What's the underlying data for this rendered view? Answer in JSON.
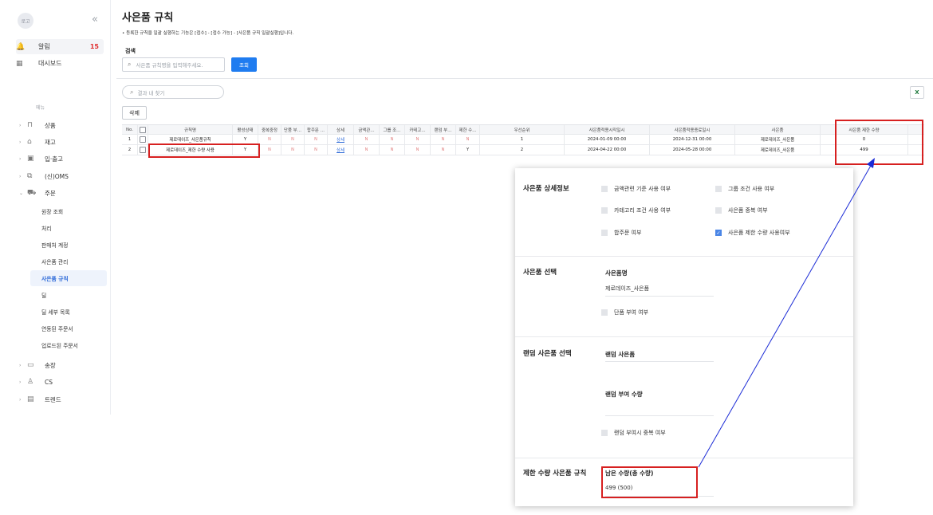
{
  "sidebar": {
    "logo": "로고",
    "collapse": "«",
    "top_items": [
      {
        "label": "알림",
        "badge": "15"
      },
      {
        "label": "대시보드"
      }
    ],
    "menu_label": "메뉴",
    "groups": [
      {
        "label": "상품",
        "arrow": "›"
      },
      {
        "label": "재고",
        "arrow": "›"
      },
      {
        "label": "입·출고",
        "arrow": "›"
      },
      {
        "label": "(신)OMS",
        "arrow": "›"
      },
      {
        "label": "주문",
        "arrow": "⌄"
      }
    ],
    "order_subitems": [
      "원장 조회",
      "처리",
      "판매처 계정",
      "사은품 관리",
      "사은품 규칙",
      "딜",
      "딜 세부 목록",
      "연동된 주문서",
      "업로드된 주문서"
    ],
    "groups_bottom": [
      {
        "label": "송장",
        "arrow": "›"
      },
      {
        "label": "CS",
        "arrow": "›"
      },
      {
        "label": "트렌드",
        "arrow": "›"
      }
    ]
  },
  "main": {
    "title": "사은품 규칙",
    "notice": "• 등록한 규칙을 일괄 실행하는 기능은 [접수] - [접수 가능] - [사은품 규칙 일괄실행]입니다.",
    "search_label": "검색",
    "search_placeholder": "사은품 규칙명을 입력해주세요.",
    "search_button": "조회",
    "find_placeholder": "결과 내 찾기",
    "delete_button": "삭제",
    "excel_icon": "excel-icon"
  },
  "grid": {
    "headers": [
      "No.",
      "",
      "규칙명",
      "활성상태",
      "중복중정",
      "단품 부…",
      "합주문 …",
      "상세",
      "금액관…",
      "그룹 조…",
      "카테고…",
      "랜덤 부…",
      "제한 수…",
      "우선순위",
      "사은품적용시작일시",
      "사은품적용종료일시",
      "사은품",
      "사은품 제한 수량"
    ],
    "rows": [
      [
        "1",
        "",
        "제로데이즈_사은품규칙",
        "Y",
        "N",
        "N",
        "N",
        "상세",
        "N",
        "N",
        "N",
        "N",
        "N",
        "1",
        "2024-01-09 00:00",
        "2024-12-31 00:00",
        "제로데이즈_사은품",
        "0"
      ],
      [
        "2",
        "",
        "제로데이즈_제한 수량 사용",
        "Y",
        "N",
        "N",
        "N",
        "상세",
        "N",
        "N",
        "N",
        "N",
        "Y",
        "2",
        "2024-04-22 00:00",
        "2024-05-28 00:00",
        "제로데이즈_사은품",
        "499"
      ]
    ]
  },
  "panel": {
    "detail_title": "사은품 상세정보",
    "detail_options": [
      {
        "label": "금액관련 기준 사용 여부",
        "checked": false
      },
      {
        "label": "그룹 조건 사용 여부",
        "checked": false
      },
      {
        "label": "카테고리 조건 사용 여부",
        "checked": false
      },
      {
        "label": "사은품 중복 여부",
        "checked": false
      },
      {
        "label": "합주문 여부",
        "checked": false
      },
      {
        "label": "사은품 제한 수량 사용여부",
        "checked": true
      }
    ],
    "select_title": "사은품 선택",
    "gift_name_label": "사은품명",
    "gift_name_value": "제로데이즈_사은품",
    "single_option": "단품 부여 여부",
    "random_title": "랜덤 사은품 선택",
    "random_gift_label": "랜덤 사은품",
    "random_qty_label": "랜덤 부여 수량",
    "random_dup_option": "랜덤 부여시 중복 여부",
    "limit_title": "제한 수량 사은품 규칙",
    "remaining_label": "남은 수량(총 수량)",
    "remaining_value": "499 (500)"
  },
  "colors": {
    "accent": "#1f7cf0",
    "annotation": "#d72020",
    "arrow": "#1b2bd6",
    "badge": "#e03030"
  }
}
